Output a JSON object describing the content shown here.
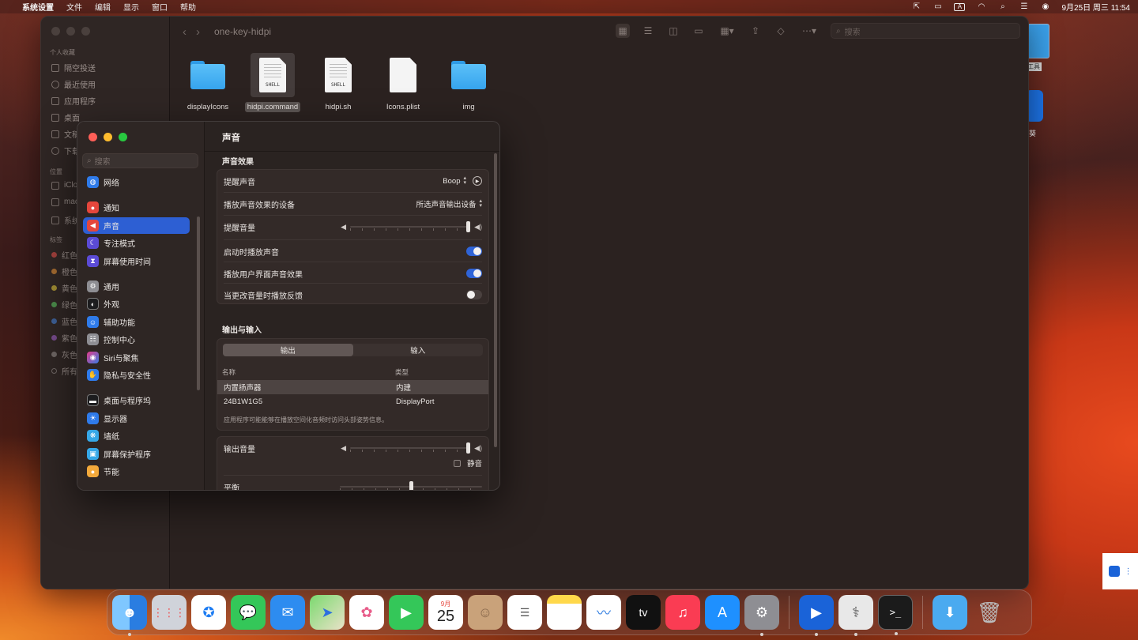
{
  "menubar": {
    "app_name": "系统设置",
    "items": [
      "文件",
      "编辑",
      "显示",
      "窗口",
      "帮助"
    ],
    "input_source": "A",
    "datetime": "9月25日 周三  11:54"
  },
  "finder": {
    "path_title": "one-key-hidpi",
    "search_placeholder": "搜索",
    "sidebar": {
      "favorites_label": "个人收藏",
      "favorites": [
        "隔空投送",
        "最近使用",
        "应用程序",
        "桌面",
        "文稿",
        "下载"
      ],
      "locations_label": "位置",
      "locations": [
        "iClo",
        "mac",
        "系统"
      ],
      "tags_label": "标签",
      "tags": [
        {
          "label": "红色",
          "color": "#e0443e"
        },
        {
          "label": "橙色",
          "color": "#ef8a2a"
        },
        {
          "label": "黄色",
          "color": "#e6c229"
        },
        {
          "label": "绿色",
          "color": "#4bbf4b"
        },
        {
          "label": "蓝色",
          "color": "#3b82f6"
        },
        {
          "label": "紫色",
          "color": "#a35bd1"
        },
        {
          "label": "灰色",
          "color": "#8e8e8e"
        },
        {
          "label": "所有",
          "color": "none"
        }
      ]
    },
    "files": [
      {
        "name": "displayIcons",
        "kind": "folder"
      },
      {
        "name": "hidpi.command",
        "kind": "shell",
        "tag": "SHELL",
        "selected": true
      },
      {
        "name": "hidpi.sh",
        "kind": "shell",
        "tag": "SHELL"
      },
      {
        "name": "Icons.plist",
        "kind": "document"
      },
      {
        "name": "img",
        "kind": "folder"
      }
    ]
  },
  "settings": {
    "search_placeholder": "搜索",
    "sidebar": [
      {
        "label": "网络",
        "icon": "globe-icon",
        "color": "#2f7bea"
      },
      {
        "label": "通知",
        "icon": "bell-icon",
        "color": "#e5463c"
      },
      {
        "label": "声音",
        "icon": "speaker-icon",
        "color": "#e5463c",
        "active": true
      },
      {
        "label": "专注模式",
        "icon": "moon-icon",
        "color": "#5b4bd6"
      },
      {
        "label": "屏幕使用时间",
        "icon": "hourglass-icon",
        "color": "#5b4bd6"
      },
      {
        "label": "通用",
        "icon": "gear-icon",
        "color": "#8e8e93"
      },
      {
        "label": "外观",
        "icon": "appearance-icon",
        "color": "#1c1c1e"
      },
      {
        "label": "辅助功能",
        "icon": "accessibility-icon",
        "color": "#2f7bea"
      },
      {
        "label": "控制中心",
        "icon": "control-center-icon",
        "color": "#8e8e93"
      },
      {
        "label": "Siri与聚焦",
        "icon": "siri-icon",
        "color": "#b0399f"
      },
      {
        "label": "隐私与安全性",
        "icon": "hand-icon",
        "color": "#2f7bea"
      },
      {
        "label": "桌面与程序坞",
        "icon": "dock-icon",
        "color": "#1c1c1e"
      },
      {
        "label": "显示器",
        "icon": "display-icon",
        "color": "#2f7bea"
      },
      {
        "label": "墙纸",
        "icon": "wallpaper-icon",
        "color": "#36a8e8"
      },
      {
        "label": "屏幕保护程序",
        "icon": "screensaver-icon",
        "color": "#36a8e8"
      },
      {
        "label": "节能",
        "icon": "bulb-icon",
        "color": "#f2a93b"
      }
    ],
    "title": "声音",
    "effects": {
      "section": "声音效果",
      "alert_sound_label": "提醒声音",
      "alert_sound_value": "Boop",
      "device_label": "播放声音效果的设备",
      "device_value": "所选声音输出设备",
      "alert_volume_label": "提醒音量",
      "alert_volume": 1.0,
      "startup_label": "启动时播放声音",
      "startup_on": true,
      "ui_effects_label": "播放用户界面声音效果",
      "ui_effects_on": true,
      "feedback_label": "当更改音量时播放反馈",
      "feedback_on": false
    },
    "io": {
      "section": "输出与输入",
      "tabs": [
        "输出",
        "输入"
      ],
      "active_tab": "输出",
      "col_name": "名称",
      "col_type": "类型",
      "devices": [
        {
          "name": "内置扬声器",
          "type": "内建",
          "selected": true
        },
        {
          "name": "24B1W1G5",
          "type": "DisplayPort"
        }
      ],
      "note": "应用程序可能能够在播放空间化音频时访问头部姿势信息。"
    },
    "output": {
      "volume_label": "输出音量",
      "volume": 1.0,
      "mute_label": "静音",
      "balance_label": "平衡",
      "balance": 0.5
    }
  },
  "desktop": {
    "partial_labels": [
      "工具",
      "葵"
    ]
  },
  "dock": {
    "calendar_month": "9月",
    "calendar_day": "25"
  }
}
